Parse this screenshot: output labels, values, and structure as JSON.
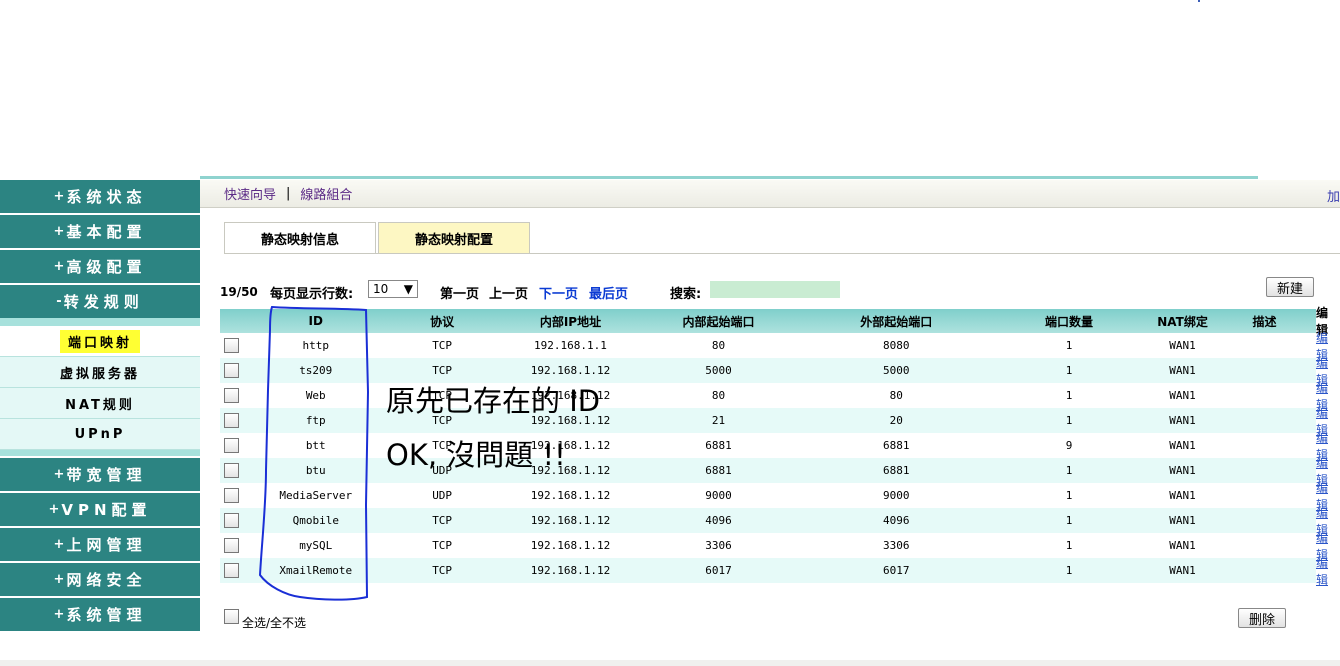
{
  "sidebar": {
    "menu_top": [
      {
        "label": "系统状态"
      },
      {
        "label": "基本配置"
      },
      {
        "label": "高级配置"
      },
      {
        "label": "转发规则",
        "prefix": "-"
      }
    ],
    "sub_items": [
      {
        "label": "端口映射",
        "active": true
      },
      {
        "label": "虚拟服务器"
      },
      {
        "label": "NAT规则"
      },
      {
        "label": "UPnP"
      }
    ],
    "menu_bottom": [
      {
        "label": "带宽管理"
      },
      {
        "label": "VPN配置"
      },
      {
        "label": "上网管理"
      },
      {
        "label": "网络安全"
      },
      {
        "label": "系统管理"
      }
    ],
    "plus_symbol": "+",
    "minus_symbol": "-"
  },
  "navbar": {
    "quick_wizard": "快速向导",
    "separator": "|",
    "line_combo": "線路組合",
    "right_partial": "加"
  },
  "tabs": {
    "info": "静态映射信息",
    "config": "静态映射配置"
  },
  "toolbar": {
    "count": "19/50",
    "rows_label": "每页显示行数:",
    "rows_value": "10",
    "first_page": "第一页",
    "prev_page": "上一页",
    "next_page": "下一页",
    "last_page": "最后页",
    "search_label": "搜索:",
    "new_button": "新建"
  },
  "table": {
    "headers": [
      "ID",
      "协议",
      "内部IP地址",
      "内部起始端口",
      "外部起始端口",
      "端口数量",
      "NAT绑定",
      "描述",
      "编辑"
    ],
    "rows": [
      {
        "id": "http",
        "protocol": "TCP",
        "ip": "192.168.1.1",
        "in_port": "80",
        "out_port": "8080",
        "count": "1",
        "nat": "WAN1",
        "desc": "",
        "edit": "编辑"
      },
      {
        "id": "ts209",
        "protocol": "TCP",
        "ip": "192.168.1.12",
        "in_port": "5000",
        "out_port": "5000",
        "count": "1",
        "nat": "WAN1",
        "desc": "",
        "edit": "编辑"
      },
      {
        "id": "Web",
        "protocol": "TCP",
        "ip": "192.168.1.12",
        "in_port": "80",
        "out_port": "80",
        "count": "1",
        "nat": "WAN1",
        "desc": "",
        "edit": "编辑"
      },
      {
        "id": "ftp",
        "protocol": "TCP",
        "ip": "192.168.1.12",
        "in_port": "21",
        "out_port": "20",
        "count": "1",
        "nat": "WAN1",
        "desc": "",
        "edit": "编辑"
      },
      {
        "id": "btt",
        "protocol": "TCP",
        "ip": "192.168.1.12",
        "in_port": "6881",
        "out_port": "6881",
        "count": "9",
        "nat": "WAN1",
        "desc": "",
        "edit": "编辑"
      },
      {
        "id": "btu",
        "protocol": "UDP",
        "ip": "192.168.1.12",
        "in_port": "6881",
        "out_port": "6881",
        "count": "1",
        "nat": "WAN1",
        "desc": "",
        "edit": "编辑"
      },
      {
        "id": "MediaServer",
        "protocol": "UDP",
        "ip": "192.168.1.12",
        "in_port": "9000",
        "out_port": "9000",
        "count": "1",
        "nat": "WAN1",
        "desc": "",
        "edit": "编辑"
      },
      {
        "id": "Qmobile",
        "protocol": "TCP",
        "ip": "192.168.1.12",
        "in_port": "4096",
        "out_port": "4096",
        "count": "1",
        "nat": "WAN1",
        "desc": "",
        "edit": "编辑"
      },
      {
        "id": "mySQL",
        "protocol": "TCP",
        "ip": "192.168.1.12",
        "in_port": "3306",
        "out_port": "3306",
        "count": "1",
        "nat": "WAN1",
        "desc": "",
        "edit": "编辑"
      },
      {
        "id": "XmailRemote",
        "protocol": "TCP",
        "ip": "192.168.1.12",
        "in_port": "6017",
        "out_port": "6017",
        "count": "1",
        "nat": "WAN1",
        "desc": "",
        "edit": "编辑"
      }
    ]
  },
  "footer": {
    "select_all": "全选/全不选",
    "delete_button": "删除"
  },
  "annotation": {
    "line1": "原先已存在的 ID",
    "line2": "OK, 沒問題 !!",
    "color": "#1a2fd6"
  }
}
